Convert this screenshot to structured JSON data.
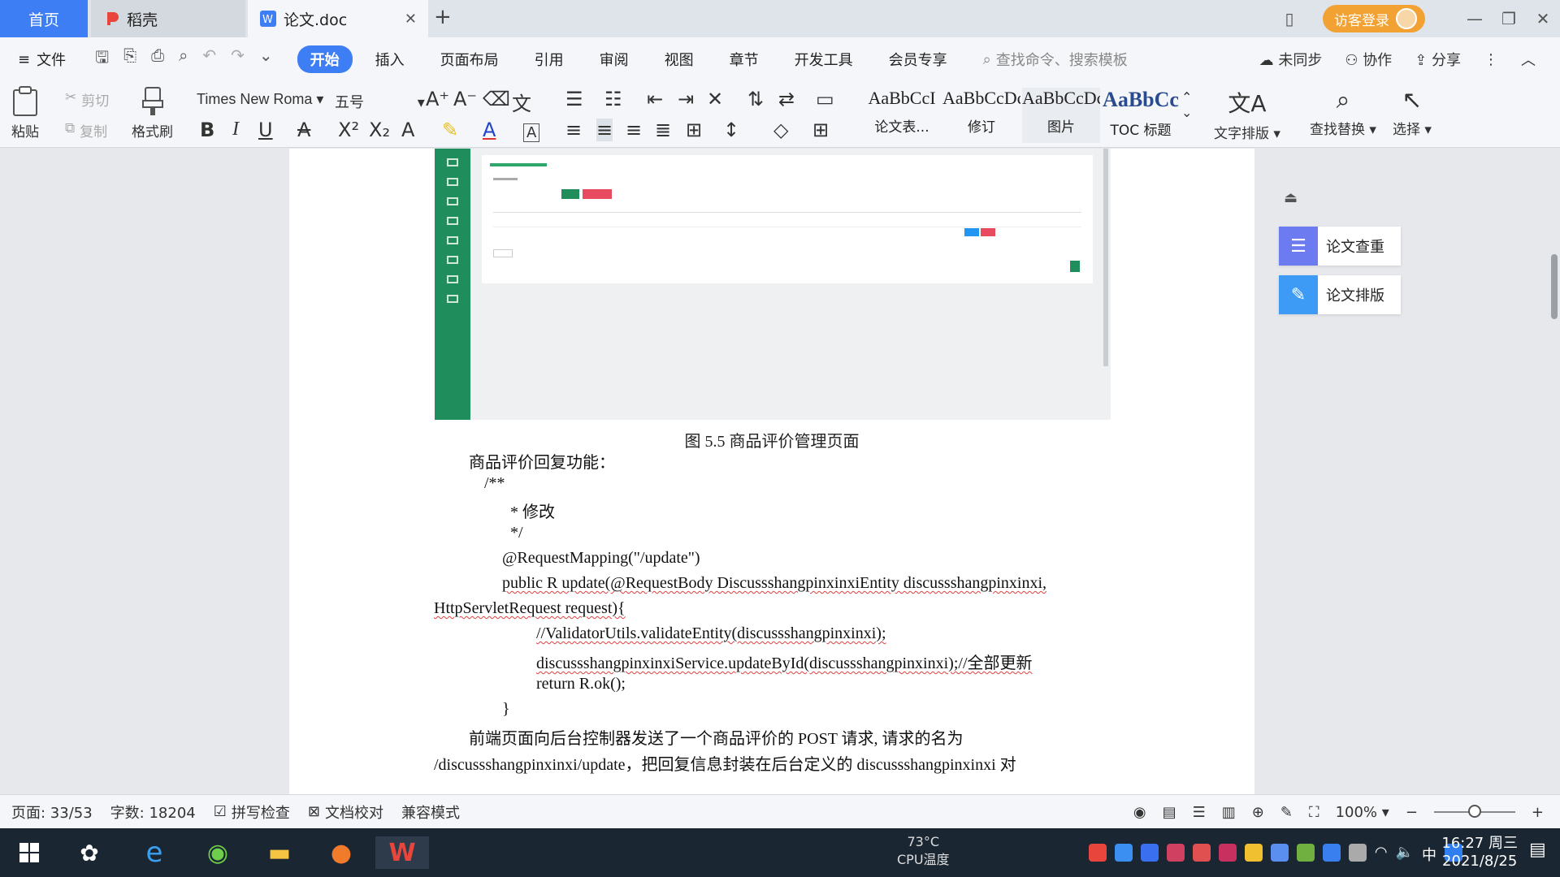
{
  "tabs": {
    "home": "首页",
    "daoke": "稻壳",
    "doc": "论文.doc",
    "visitor": "访客登录"
  },
  "menu": {
    "file": "文件",
    "items": [
      "开始",
      "插入",
      "页面布局",
      "引用",
      "审阅",
      "视图",
      "章节",
      "开发工具",
      "会员专享"
    ],
    "search_placeholder": "查找命令、搜索模板",
    "sync": "未同步",
    "collab": "协作",
    "share": "分享"
  },
  "ribbon": {
    "paste": "粘贴",
    "cut": "剪切",
    "copy": "复制",
    "format_painter": "格式刷",
    "font": "Times New Roma",
    "size": "五号",
    "styles": [
      {
        "sample": "AaBbCcI",
        "label": "论文表..."
      },
      {
        "sample": "AaBbCcDc",
        "label": "修订"
      },
      {
        "sample": "AaBbCcDc",
        "label": "图片"
      },
      {
        "sample": "AaBbCc",
        "label": "TOC 标题"
      }
    ],
    "text_layout": "文字排版",
    "find_replace": "查找替换",
    "select": "选择"
  },
  "document": {
    "caption": "图 5.5  商品评价管理页面",
    "lines": [
      "商品评价回复功能：",
      "/**",
      "* 修改",
      "*/",
      "@RequestMapping(\"/update\")",
      "public R update(@RequestBody DiscussshangpinxinxiEntity discussshangpinxinxi,",
      "HttpServletRequest request){",
      "//ValidatorUtils.validateEntity(discussshangpinxinxi);",
      "discussshangpinxinxiService.updateById(discussshangpinxinxi);//全部更新",
      "return R.ok();",
      "}",
      "前端页面向后台控制器发送了一个商品评价的 POST 请求, 请求的名为",
      "/discussshangpinxinxi/update，把回复信息封装在后台定义的 discussshangpinxinxi 对"
    ]
  },
  "side_panel": {
    "check": "论文查重",
    "layout": "论文排版"
  },
  "status": {
    "page": "页面: 33/53",
    "words": "字数: 18204",
    "spell": "拼写检查",
    "proof": "文档校对",
    "compat": "兼容模式",
    "zoom": "100%",
    "zoom_level": 0.5
  },
  "taskbar": {
    "cpu_temp": "73°C",
    "cpu_label": "CPU温度",
    "ime": "中",
    "time": "16:27 周三",
    "date": "2021/8/25"
  },
  "colors": {
    "accent": "#3d7ef5",
    "visitor": "#f2a133",
    "sidebar_green": "#1f8e5c"
  }
}
